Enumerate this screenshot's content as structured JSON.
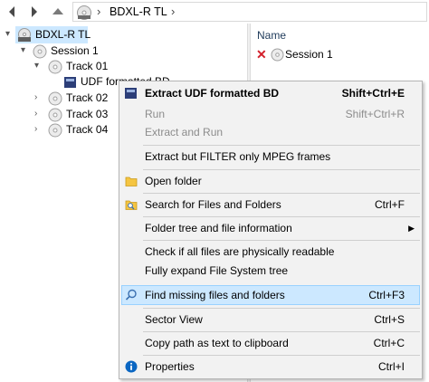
{
  "address": {
    "crumb": "BDXL-R TL",
    "sep": "›"
  },
  "tree": {
    "root": "BDXL-R TL",
    "session": "Session 1",
    "tracks": [
      "Track 01",
      "Track 02",
      "Track 03",
      "Track 04"
    ],
    "udf": "UDF formatted BD"
  },
  "list": {
    "column_name": "Name",
    "rows": [
      {
        "label": "Session 1",
        "status": "missing"
      }
    ]
  },
  "menu": {
    "extract_udf": {
      "label": "Extract UDF formatted BD",
      "shortcut": "Shift+Ctrl+E"
    },
    "run": {
      "label": "Run",
      "shortcut": "Shift+Ctrl+R"
    },
    "extract_run": {
      "label": "Extract and Run"
    },
    "extract_filter": {
      "label": "Extract but FILTER only MPEG frames"
    },
    "open_folder": {
      "label": "Open folder"
    },
    "search": {
      "label": "Search for Files and Folders",
      "shortcut": "Ctrl+F"
    },
    "folder_tree": {
      "label": "Folder tree and file information",
      "arrow": "▶"
    },
    "check": {
      "label": "Check if all files are physically readable"
    },
    "expand": {
      "label": "Fully expand File System tree"
    },
    "find_missing": {
      "label": "Find missing files and folders",
      "shortcut": "Ctrl+F3"
    },
    "sector_view": {
      "label": "Sector View",
      "shortcut": "Ctrl+S"
    },
    "copy_path": {
      "label": "Copy path as text to clipboard",
      "shortcut": "Ctrl+C"
    },
    "properties": {
      "label": "Properties",
      "shortcut": "Ctrl+I"
    }
  },
  "colors": {
    "selection": "#cce8ff",
    "menu_bg": "#f2f2f2",
    "disabled_text": "#8c8c8c",
    "error_red": "#d3202b",
    "info_blue": "#0a66c2",
    "folder_yellow": "#f5c542"
  },
  "icons": [
    "back-arrow-icon",
    "forward-arrow-icon",
    "up-arrow-icon",
    "disc-icon",
    "udf-badge-icon",
    "folder-icon",
    "search-folder-icon",
    "search-icon",
    "info-icon",
    "missing-x-icon"
  ]
}
